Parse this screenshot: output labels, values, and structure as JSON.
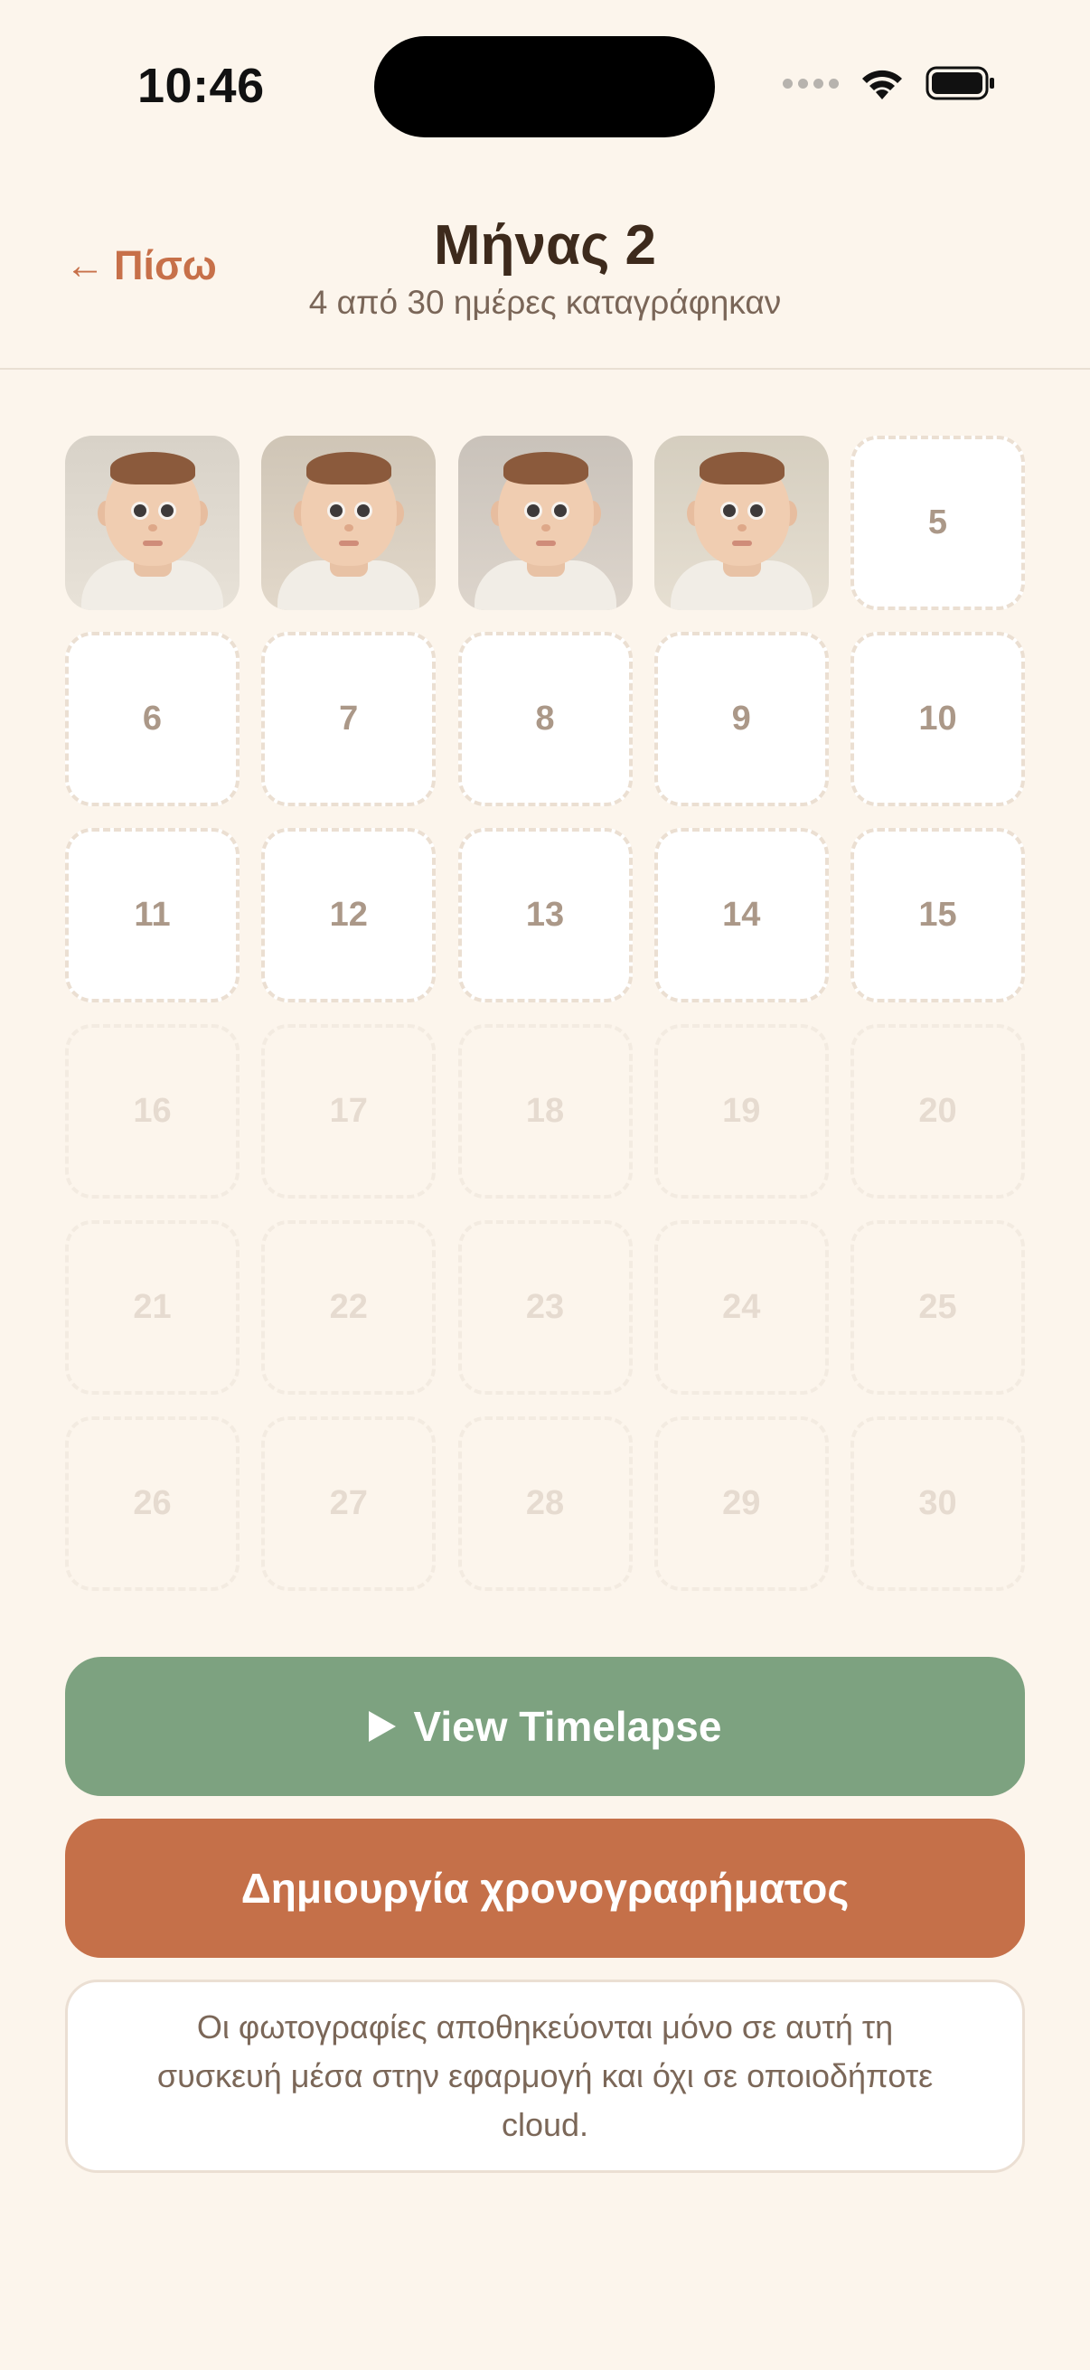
{
  "status_bar": {
    "time": "10:46",
    "icons": [
      "signal-dots-icon",
      "wifi-icon",
      "battery-icon"
    ]
  },
  "header": {
    "back_arrow": "←",
    "back_label": "Πίσω",
    "title": "Μήνας 2",
    "subtitle": "4 από 30 ημέρες καταγράφηκαν"
  },
  "grid": {
    "photo_days": [
      1,
      2,
      3,
      4
    ],
    "empty_days": [
      "5",
      "6",
      "7",
      "8",
      "9",
      "10",
      "11",
      "12",
      "13",
      "14",
      "15"
    ],
    "future_days": [
      "16",
      "17",
      "18",
      "19",
      "20",
      "21",
      "22",
      "23",
      "24",
      "25",
      "26",
      "27",
      "28",
      "29",
      "30"
    ]
  },
  "actions": {
    "timelapse_label": "View Timelapse",
    "create_label": "Δημιουργία χρονογραφήματος"
  },
  "info": {
    "text": "Οι φωτογραφίες αποθηκεύονται μόνο σε αυτή τη συσκευή μέσα στην εφαρμογή και όχι σε οποιοδήποτε cloud."
  },
  "colors": {
    "background": "#fcf5ec",
    "accent": "#c57049",
    "timelapse_button": "#7da280",
    "title": "#3d2a1c"
  }
}
